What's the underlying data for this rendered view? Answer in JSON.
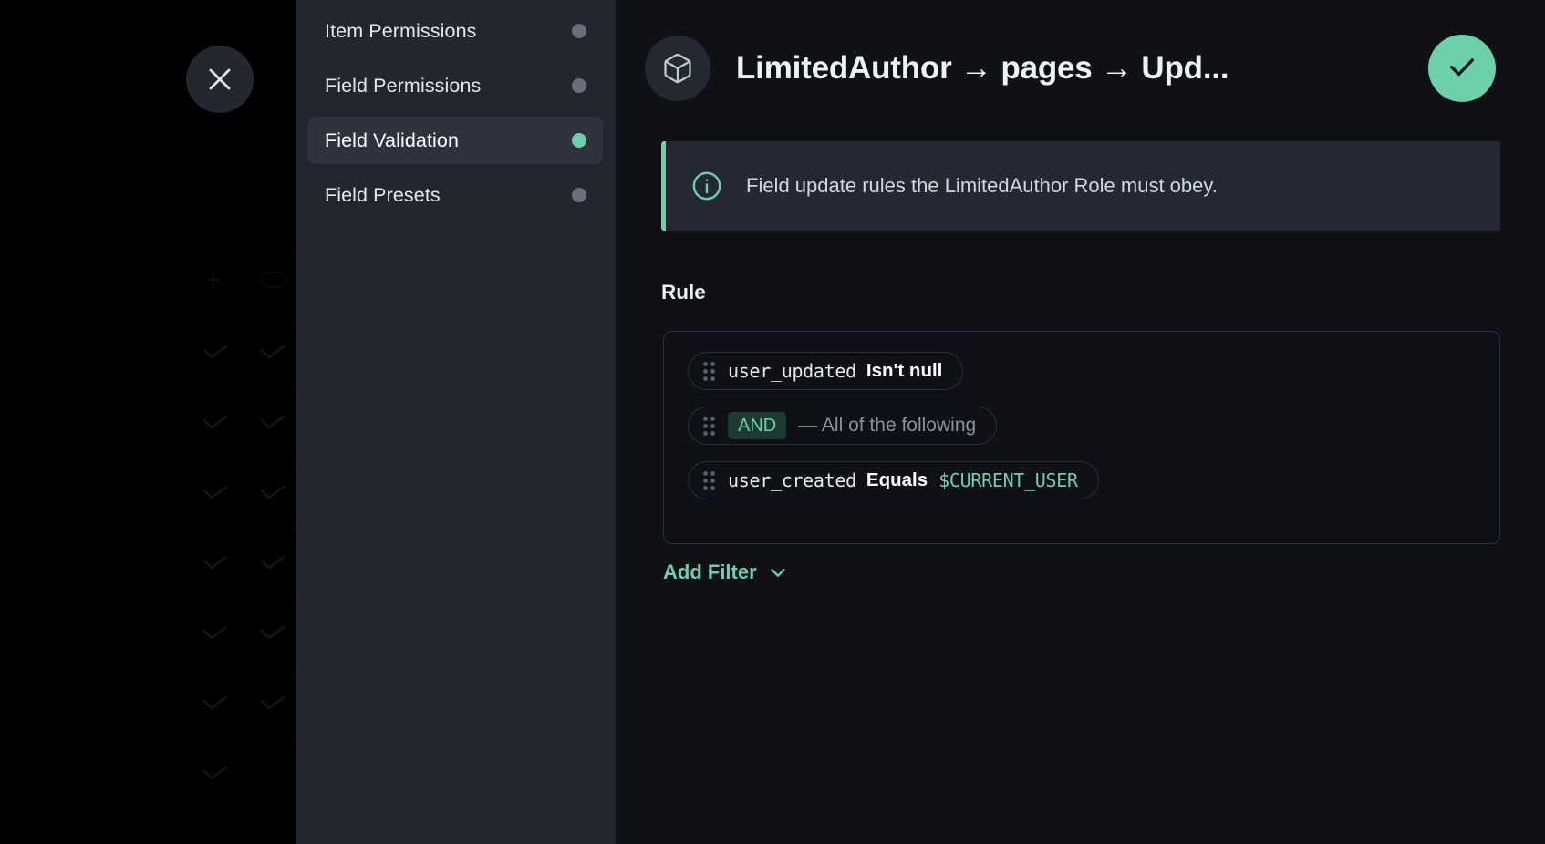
{
  "backdrop": {
    "add_icon": "plus-icon",
    "visibility_icon": "eye-icon",
    "check_icon": "check-icon",
    "rows": 8
  },
  "close_button": {
    "icon": "close-icon",
    "label": "Close"
  },
  "sidebar": {
    "items": [
      {
        "label": "Item Permissions",
        "active": false,
        "dot": "inactive"
      },
      {
        "label": "Field Permissions",
        "active": false,
        "dot": "inactive"
      },
      {
        "label": "Field Validation",
        "active": true,
        "dot": "active"
      },
      {
        "label": "Field Presets",
        "active": false,
        "dot": "inactive"
      }
    ]
  },
  "header": {
    "icon": "cube-icon",
    "title": "LimitedAuthor → pages → Upd...",
    "save": {
      "icon": "check-icon",
      "label": "Save"
    }
  },
  "banner": {
    "icon": "info-icon",
    "text": "Field update rules the LimitedAuthor Role must obey."
  },
  "rule": {
    "label": "Rule",
    "filters": [
      {
        "handle": "drag-handle-icon",
        "field": "user_updated",
        "operator": "Isn't null",
        "value": ""
      },
      {
        "handle": "drag-handle-icon",
        "badge": "AND",
        "description": "— All of the following"
      },
      {
        "handle": "drag-handle-icon",
        "field": "user_created",
        "operator": "Equals",
        "value": "$CURRENT_USER"
      }
    ]
  },
  "add_filter": {
    "label": "Add Filter",
    "icon": "chevron-down-icon"
  },
  "colors": {
    "accent_green": "#6ecfab",
    "panel_bg": "#23262f",
    "main_bg": "#0f1116",
    "banner_bg": "#232833",
    "border": "#2c3039",
    "text_primary": "#eef1f5",
    "text_muted": "#8c919c"
  }
}
